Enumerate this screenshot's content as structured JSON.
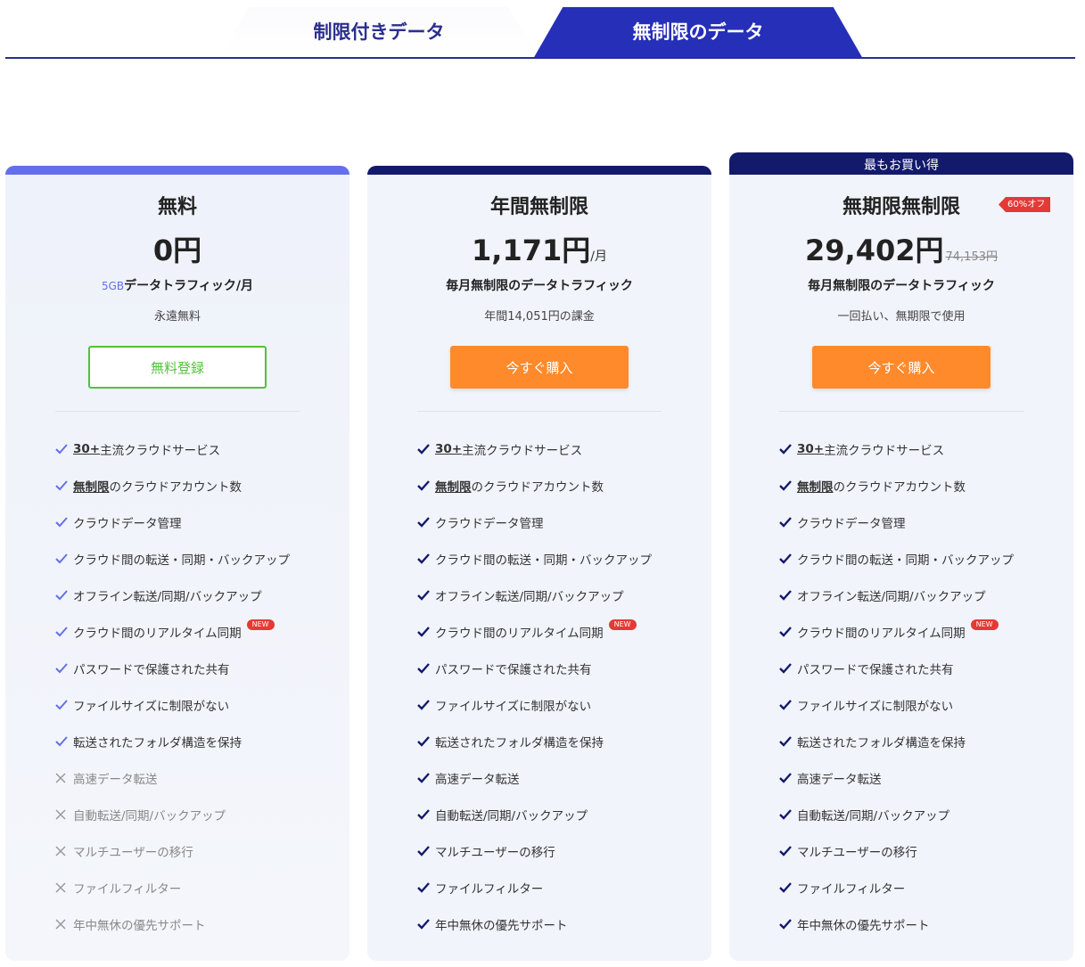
{
  "tabs": [
    {
      "label": "制限付きデータ",
      "active": false
    },
    {
      "label": "無制限のデータ",
      "active": true
    }
  ],
  "colors": {
    "primary": "#262fb8",
    "dark": "#131a6b",
    "free_accent": "#6470ea",
    "buy_button": "#ff8a2b",
    "free_button": "#52c23a",
    "badge": "#e53935"
  },
  "plans": [
    {
      "name": "無料",
      "price": "0円",
      "unit": "",
      "old_price": "",
      "traffic_gb": "5GB",
      "traffic": "データトラフィック/月",
      "note": "永遠無料",
      "button": "無料登録",
      "ribbon": "",
      "discount": ""
    },
    {
      "name": "年間無制限",
      "price": "1,171円",
      "unit": "/月",
      "old_price": "",
      "traffic_gb": "",
      "traffic": "毎月無制限のデータトラフィック",
      "note": "年間14,051円の課金",
      "button": "今すぐ購入",
      "ribbon": "",
      "discount": ""
    },
    {
      "name": "無期限無制限",
      "price": "29,402円",
      "unit": "",
      "old_price": "74,153円",
      "traffic_gb": "",
      "traffic": "毎月無制限のデータトラフィック",
      "note": "一回払い、無期限で使用",
      "button": "今すぐ購入",
      "ribbon": "最もお買い得",
      "discount": "60%オフ"
    }
  ],
  "features": {
    "f1_num": "30+",
    "f1_rest": " 主流クラウドサービス",
    "f2_hl": "無制限",
    "f2_rest": " のクラウドアカウント数",
    "f3": "クラウドデータ管理",
    "f4": "クラウド間の転送・同期・バックアップ",
    "f5": "オフライン転送/同期/バックアップ",
    "f6": "クラウド間のリアルタイム同期",
    "f6_badge": "NEW",
    "f7": "パスワードで保護された共有",
    "f8": "ファイルサイズに制限がない",
    "f9": "転送されたフォルダ構造を保持",
    "f10": "高速データ転送",
    "f11": "自動転送/同期/バックアップ",
    "f12": "マルチユーザーの移行",
    "f13": "ファイルフィルター",
    "f14": "年中無休の優先サポート"
  }
}
